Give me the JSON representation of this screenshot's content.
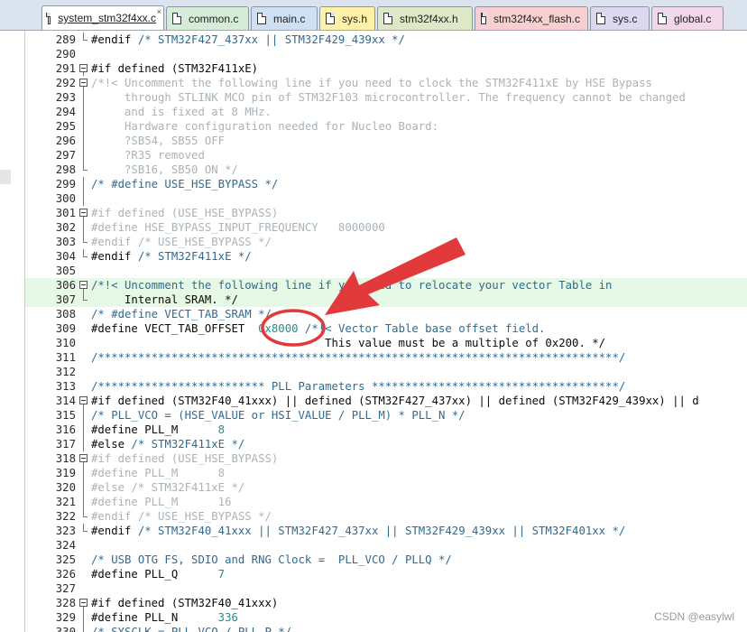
{
  "tabs": [
    {
      "label": "system_stm32f4xx.c",
      "color": "#ffffff",
      "active": true
    },
    {
      "label": "common.c",
      "color": "#d4ecd8",
      "active": false
    },
    {
      "label": "main.c",
      "color": "#cfe0f5",
      "active": false
    },
    {
      "label": "sys.h",
      "color": "#fff2a8",
      "active": false
    },
    {
      "label": "stm32f4xx.h",
      "color": "#dfe8c6",
      "active": false
    },
    {
      "label": "stm32f4xx_flash.c",
      "color": "#f7cfd1",
      "active": false
    },
    {
      "label": "sys.c",
      "color": "#ddd8f0",
      "active": false
    },
    {
      "label": "global.c",
      "color": "#f2d6ea",
      "active": false
    }
  ],
  "code_lines": [
    {
      "num": "289",
      "fold": "end",
      "text": "#endif /* STM32F427_437xx || STM32F429_439xx */"
    },
    {
      "num": "290",
      "fold": "",
      "text": ""
    },
    {
      "num": "291",
      "fold": "open",
      "text": "#if defined (STM32F411xE)"
    },
    {
      "num": "292",
      "fold": "open",
      "text": "/*!< Uncomment the following line if you need to clock the STM32F411xE by HSE Bypass"
    },
    {
      "num": "293",
      "fold": "mid",
      "text": "     through STLINK MCO pin of STM32F103 microcontroller. The frequency cannot be changed"
    },
    {
      "num": "294",
      "fold": "mid",
      "text": "     and is fixed at 8 MHz."
    },
    {
      "num": "295",
      "fold": "mid",
      "text": "     Hardware configuration needed for Nucleo Board:"
    },
    {
      "num": "296",
      "fold": "mid",
      "text": "     ?SB54, SB55 OFF"
    },
    {
      "num": "297",
      "fold": "mid",
      "text": "     ?R35 removed"
    },
    {
      "num": "298",
      "fold": "end",
      "text": "     ?SB16, SB50 ON */"
    },
    {
      "num": "299",
      "fold": "mid",
      "text": "/* #define USE_HSE_BYPASS */"
    },
    {
      "num": "300",
      "fold": "mid",
      "text": ""
    },
    {
      "num": "301",
      "fold": "open",
      "text": "#if defined (USE_HSE_BYPASS)"
    },
    {
      "num": "302",
      "fold": "mid",
      "text": "#define HSE_BYPASS_INPUT_FREQUENCY   8000000"
    },
    {
      "num": "303",
      "fold": "end",
      "text": "#endif /* USE_HSE_BYPASS */"
    },
    {
      "num": "304",
      "fold": "end",
      "text": "#endif /* STM32F411xE */"
    },
    {
      "num": "305",
      "fold": "",
      "text": ""
    },
    {
      "num": "306",
      "fold": "open",
      "text": "/*!< Uncomment the following line if you need to relocate your vector Table in"
    },
    {
      "num": "307",
      "fold": "end",
      "text": "     Internal SRAM. */"
    },
    {
      "num": "308",
      "fold": "",
      "text": "/* #define VECT_TAB_SRAM */"
    },
    {
      "num": "309",
      "fold": "",
      "text": "#define VECT_TAB_OFFSET  0x8000 /*!< Vector Table base offset field."
    },
    {
      "num": "310",
      "fold": "",
      "text": "                                   This value must be a multiple of 0x200. */"
    },
    {
      "num": "311",
      "fold": "",
      "text": "/******************************************************************************/"
    },
    {
      "num": "312",
      "fold": "",
      "text": ""
    },
    {
      "num": "313",
      "fold": "",
      "text": "/************************* PLL Parameters *************************************/"
    },
    {
      "num": "314",
      "fold": "open",
      "text": "#if defined (STM32F40_41xxx) || defined (STM32F427_437xx) || defined (STM32F429_439xx) || d"
    },
    {
      "num": "315",
      "fold": "mid",
      "text": "/* PLL_VCO = (HSE_VALUE or HSI_VALUE / PLL_M) * PLL_N */"
    },
    {
      "num": "316",
      "fold": "mid",
      "text": "#define PLL_M      8"
    },
    {
      "num": "317",
      "fold": "mid",
      "text": "#else /* STM32F411xE */"
    },
    {
      "num": "318",
      "fold": "open",
      "text": "#if defined (USE_HSE_BYPASS)"
    },
    {
      "num": "319",
      "fold": "mid",
      "text": "#define PLL_M      8"
    },
    {
      "num": "320",
      "fold": "mid",
      "text": "#else /* STM32F411xE */"
    },
    {
      "num": "321",
      "fold": "mid",
      "text": "#define PLL_M      16"
    },
    {
      "num": "322",
      "fold": "end",
      "text": "#endif /* USE_HSE_BYPASS */"
    },
    {
      "num": "323",
      "fold": "end",
      "text": "#endif /* STM32F40_41xxx || STM32F427_437xx || STM32F429_439xx || STM32F401xx */"
    },
    {
      "num": "324",
      "fold": "",
      "text": ""
    },
    {
      "num": "325",
      "fold": "",
      "text": "/* USB OTG FS, SDIO and RNG Clock =  PLL_VCO / PLLQ */"
    },
    {
      "num": "326",
      "fold": "",
      "text": "#define PLL_Q      7"
    },
    {
      "num": "327",
      "fold": "",
      "text": ""
    },
    {
      "num": "328",
      "fold": "open",
      "text": "#if defined (STM32F40_41xxx)"
    },
    {
      "num": "329",
      "fold": "mid",
      "text": "#define PLL_N      336"
    },
    {
      "num": "330",
      "fold": "mid",
      "text": "/* SYSCLK = PLL_VCO / PLL_P */"
    }
  ],
  "watermark": "CSDN @easylwl",
  "annotation_color": "#e23a3a"
}
